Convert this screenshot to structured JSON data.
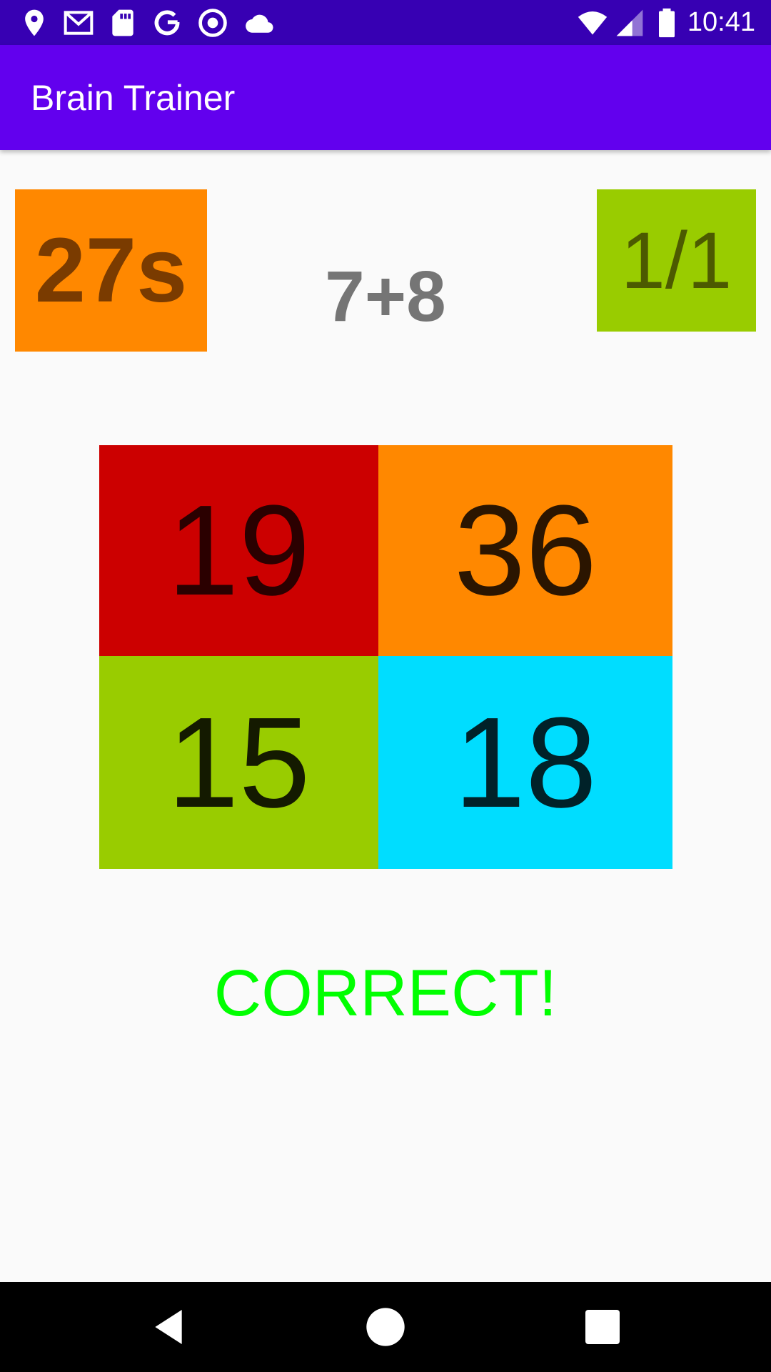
{
  "status_bar": {
    "time": "10:41",
    "left_icons": [
      "location-icon",
      "gmail-icon",
      "sd-card-icon",
      "google-icon",
      "circle-icon",
      "cloud-icon"
    ],
    "right_icons": [
      "wifi-icon",
      "signal-icon",
      "battery-icon"
    ]
  },
  "app_bar": {
    "title": "Brain Trainer"
  },
  "game": {
    "timer": "27s",
    "question": "7+8",
    "score": "1/1",
    "answers": [
      "19",
      "36",
      "15",
      "18"
    ],
    "result": "CORRECT!"
  },
  "nav_bar": {
    "icons": [
      "back-icon",
      "home-icon",
      "recents-icon"
    ]
  },
  "colors": {
    "status_bar": "#3700b3",
    "app_bar": "#6200ee",
    "timer_bg": "#ff8800",
    "score_bg": "#99cc00",
    "answer_1_bg": "#cc0000",
    "answer_2_bg": "#ff8800",
    "answer_3_bg": "#99cc00",
    "answer_4_bg": "#00ddff",
    "result_text": "#00ff00"
  }
}
